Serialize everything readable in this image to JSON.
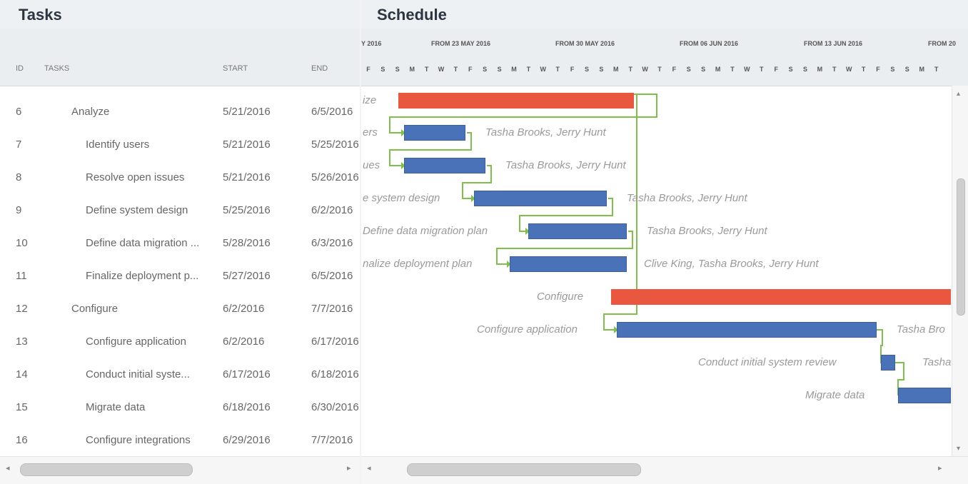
{
  "tasks_panel": {
    "title": "Tasks",
    "columns": {
      "id": "ID",
      "task": "TASKS",
      "start": "START",
      "end": "END"
    },
    "rows": [
      {
        "id": "6",
        "task": "Analyze",
        "start": "5/21/2016",
        "end": "6/5/2016"
      },
      {
        "id": "7",
        "task": "Identify users",
        "start": "5/21/2016",
        "end": "5/25/2016"
      },
      {
        "id": "8",
        "task": "Resolve open issues",
        "start": "5/21/2016",
        "end": "5/26/2016"
      },
      {
        "id": "9",
        "task": "Define system design",
        "start": "5/25/2016",
        "end": "6/2/2016"
      },
      {
        "id": "10",
        "task": "Define data migration ...",
        "start": "5/28/2016",
        "end": "6/3/2016"
      },
      {
        "id": "11",
        "task": "Finalize deployment p...",
        "start": "5/27/2016",
        "end": "6/5/2016"
      },
      {
        "id": "12",
        "task": "Configure",
        "start": "6/2/2016",
        "end": "7/7/2016"
      },
      {
        "id": "13",
        "task": "Configure application",
        "start": "6/2/2016",
        "end": "6/17/2016"
      },
      {
        "id": "14",
        "task": "Conduct initial syste...",
        "start": "6/17/2016",
        "end": "6/18/2016"
      },
      {
        "id": "15",
        "task": "Migrate data",
        "start": "6/18/2016",
        "end": "6/30/2016"
      },
      {
        "id": "16",
        "task": "Configure integrations",
        "start": "6/29/2016",
        "end": "7/7/2016"
      }
    ]
  },
  "schedule_panel": {
    "title": "Schedule",
    "weeks": [
      "Y 2016",
      "FROM 23 MAY 2016",
      "FROM 30 MAY 2016",
      "FROM 06 JUN 2016",
      "FROM 13 JUN 2016",
      "FROM 20"
    ],
    "days": [
      "F",
      "S",
      "S",
      "M",
      "T",
      "W",
      "T",
      "F",
      "S",
      "S",
      "M",
      "T",
      "W",
      "T",
      "F",
      "S",
      "S",
      "M",
      "T",
      "W",
      "T",
      "F",
      "S",
      "S",
      "M",
      "T",
      "W",
      "T",
      "F",
      "S",
      "S",
      "M",
      "T",
      "W",
      "T",
      "F",
      "S",
      "S",
      "M",
      "T"
    ],
    "bar_labels": [
      "ize",
      "ers",
      "ues",
      "e system design",
      "Define data migration plan",
      "nalize deployment plan",
      "Configure",
      "Configure application",
      "Conduct initial system review",
      "Migrate data"
    ],
    "resource_labels": [
      "Tasha Brooks, Jerry Hunt",
      "Tasha Brooks, Jerry Hunt",
      "Tasha Brooks, Jerry Hunt",
      "Tasha Brooks, Jerry Hunt",
      "Clive King, Tasha Brooks, Jerry Hunt",
      "Tasha Bro",
      "Tasha"
    ]
  },
  "colors": {
    "parent_bar": "#e9573f",
    "child_bar": "#4a72b8",
    "link": "#7ec04a"
  }
}
